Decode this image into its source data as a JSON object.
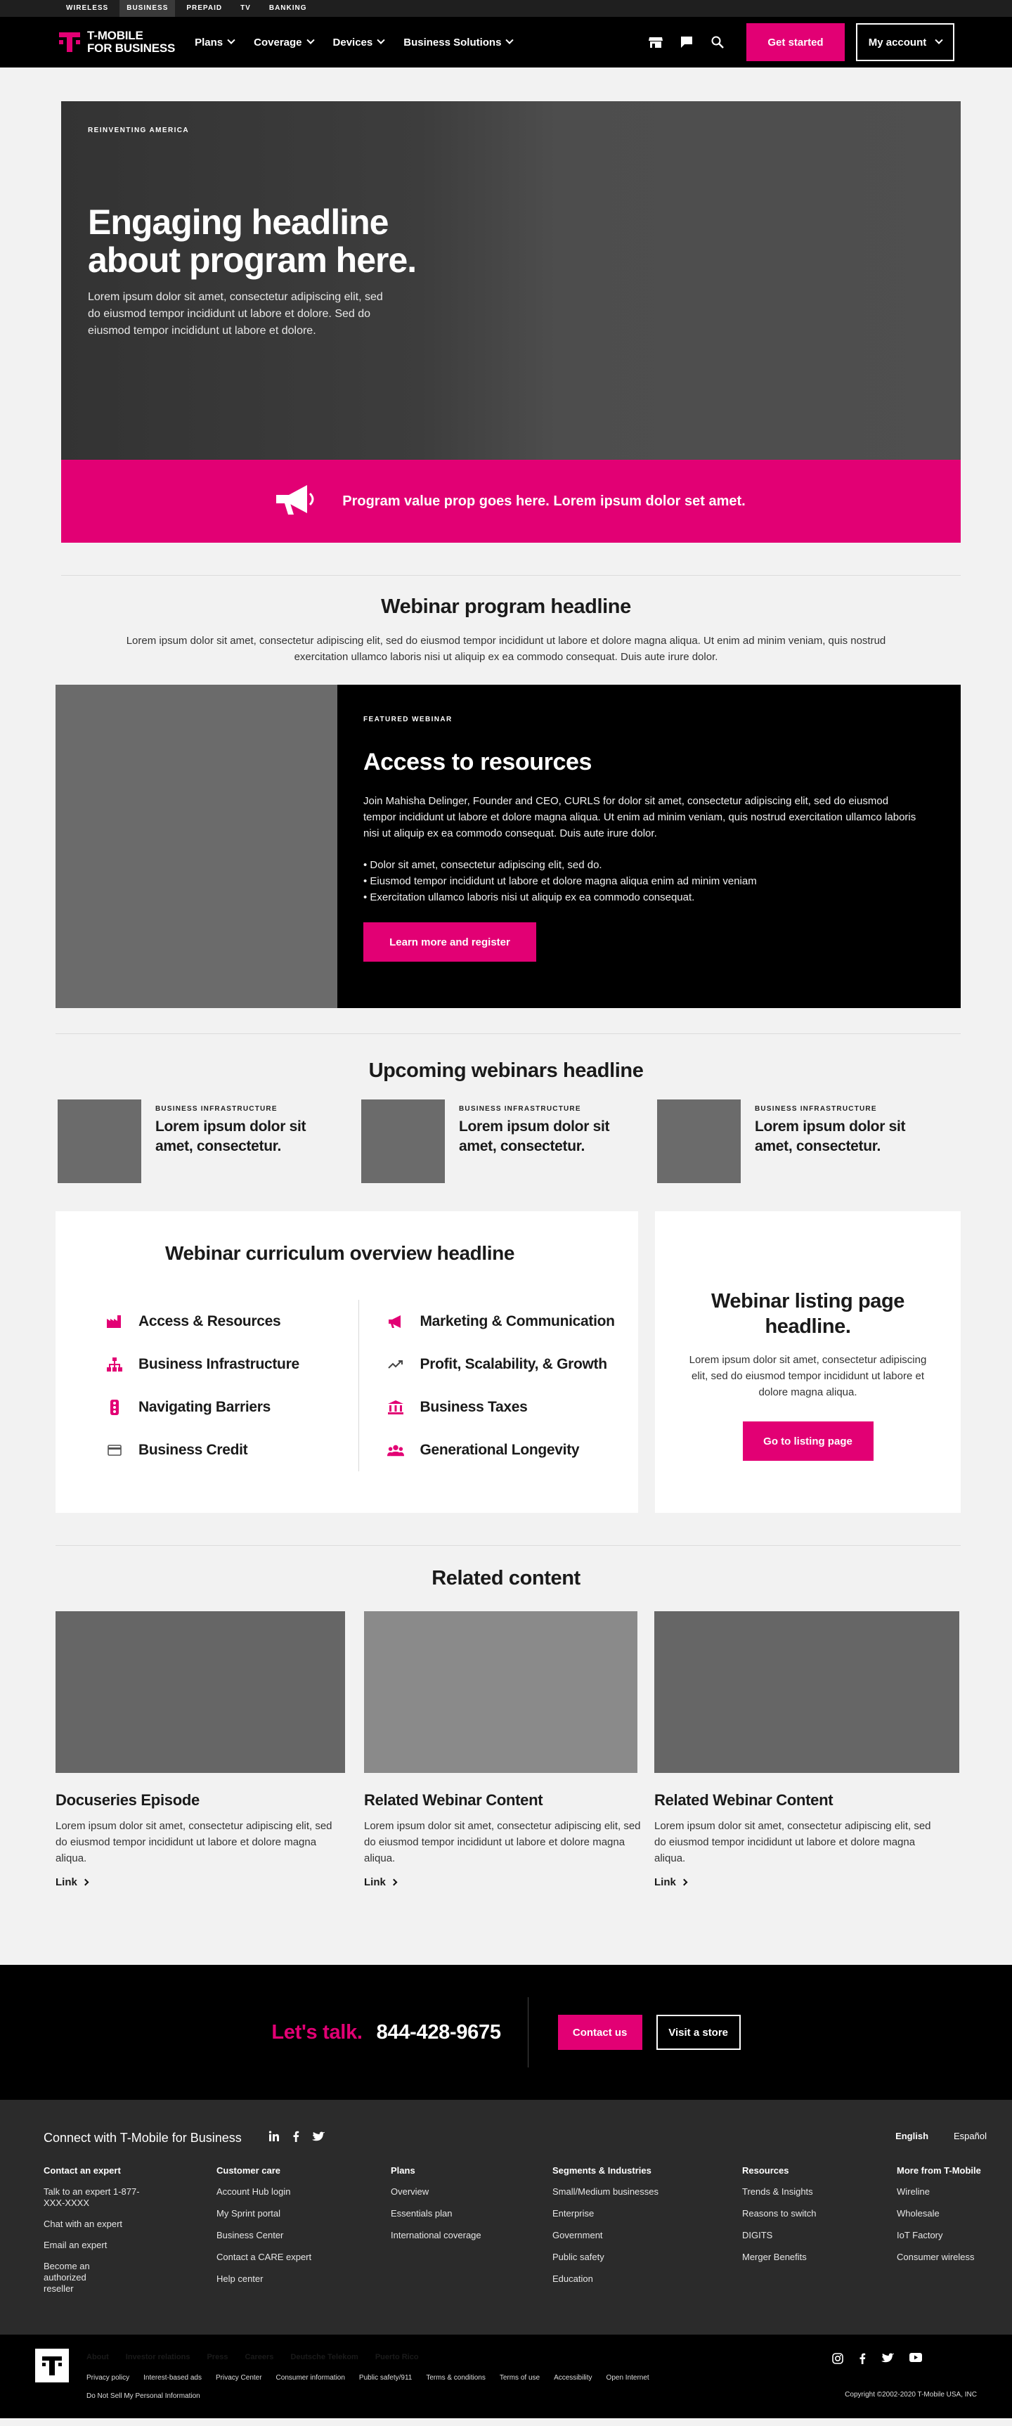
{
  "utility_bar": {
    "items": [
      "WIRELESS",
      "BUSINESS",
      "PREPAID",
      "TV",
      "BANKING"
    ],
    "active_index": 1
  },
  "nav": {
    "logo_line1": "T-MOBILE",
    "logo_line2": "FOR BUSINESS",
    "links": [
      "Plans",
      "Coverage",
      "Devices",
      "Business Solutions"
    ],
    "get_started": "Get started",
    "my_account": "My account",
    "icons": [
      "store-icon",
      "chat-icon",
      "search-icon"
    ]
  },
  "hero": {
    "eyebrow": "REINVENTING AMERICA",
    "headline": "Engaging headline about program here.",
    "body": "Lorem ipsum dolor sit amet, consectetur adipiscing elit, sed do eiusmod tempor incididunt ut labore et dolore. Sed do eiusmod tempor incididunt ut labore et dolore.",
    "value_prop": "Program value prop goes here. Lorem ipsum dolor set amet.",
    "value_icon": "megaphone-icon"
  },
  "webinar_program": {
    "headline": "Webinar program headline",
    "body": "Lorem ipsum dolor sit amet, consectetur adipiscing elit, sed do eiusmod tempor incididunt ut labore et dolore magna aliqua. Ut enim ad minim veniam, quis nostrud exercitation ullamco laboris nisi ut aliquip ex ea commodo consequat. Duis aute irure dolor."
  },
  "featured": {
    "eyebrow": "FEATURED WEBINAR",
    "title": "Access to resources",
    "description": "Join Mahisha Delinger, Founder and CEO, CURLS for dolor sit amet, consectetur adipiscing elit, sed do eiusmod tempor incididunt ut labore et dolore magna aliqua. Ut enim ad minim veniam, quis nostrud exercitation ullamco laboris nisi ut aliquip ex ea commodo consequat. Duis aute irure dolor.",
    "bullets": [
      "• Dolor sit amet, consectetur adipiscing elit, sed do.",
      "• Eiusmod tempor incididunt ut labore et dolore magna aliqua enim ad minim veniam",
      "• Exercitation ullamco laboris nisi ut aliquip ex ea commodo consequat."
    ],
    "cta": "Learn more and register"
  },
  "upcoming": {
    "headline": "Upcoming webinars headline",
    "cards": [
      {
        "eyebrow": "BUSINESS INFRASTRUCTURE",
        "title": "Lorem ipsum dolor sit amet, consectetur."
      },
      {
        "eyebrow": "BUSINESS INFRASTRUCTURE",
        "title": "Lorem ipsum dolor sit amet, consectetur."
      },
      {
        "eyebrow": "BUSINESS INFRASTRUCTURE",
        "title": "Lorem ipsum dolor sit amet, consectetur."
      }
    ]
  },
  "curriculum": {
    "headline": "Webinar curriculum overview headline",
    "left": [
      {
        "label": "Access & Resources",
        "icon": "factory-icon"
      },
      {
        "label": "Business Infrastructure",
        "icon": "org-chart-icon"
      },
      {
        "label": "Navigating Barriers",
        "icon": "traffic-light-icon"
      },
      {
        "label": "Business Credit",
        "icon": "credit-card-icon"
      }
    ],
    "right": [
      {
        "label": "Marketing & Communication",
        "icon": "megaphone-icon"
      },
      {
        "label": "Profit, Scalability, & Growth",
        "icon": "trending-up-icon"
      },
      {
        "label": "Business Taxes",
        "icon": "bank-icon"
      },
      {
        "label": "Generational Longevity",
        "icon": "people-icon"
      }
    ],
    "icon_color": "#e20074"
  },
  "listing": {
    "headline": "Webinar listing page headline.",
    "body": "Lorem ipsum dolor sit amet, consectetur adipiscing elit, sed do eiusmod tempor incididunt ut labore et dolore magna aliqua.",
    "cta": "Go to listing page"
  },
  "related": {
    "headline": "Related content",
    "cards": [
      {
        "title": "Docuseries Episode",
        "body": "Lorem ipsum dolor sit amet, consectetur adipiscing elit, sed do eiusmod tempor incididunt ut labore et dolore magna aliqua.",
        "link": "Link",
        "image_color": "#666666"
      },
      {
        "title": "Related Webinar Content",
        "body": "Lorem ipsum dolor sit amet, consectetur adipiscing elit, sed do eiusmod tempor incididunt ut labore et dolore magna aliqua.",
        "link": "Link",
        "image_color": "#8a8a8a"
      },
      {
        "title": "Related Webinar Content",
        "body": "Lorem ipsum dolor sit amet, consectetur adipiscing elit, sed do eiusmod tempor incididunt ut labore et dolore magna aliqua.",
        "link": "Link",
        "image_color": "#666666"
      }
    ]
  },
  "talk": {
    "label": "Let's talk.",
    "phone": "844-428-9675",
    "contact": "Contact us",
    "store": "Visit a store"
  },
  "footer": {
    "connect": "Connect with T-Mobile for Business",
    "socials": [
      "linkedin-icon",
      "facebook-icon",
      "twitter-icon"
    ],
    "languages": [
      "English",
      "Español"
    ],
    "columns": [
      {
        "head": "Contact an expert",
        "items": [
          "Talk to an expert 1-877-XXX-XXXX",
          "Chat with an expert",
          "Email an expert",
          "Become an authorized reseller"
        ]
      },
      {
        "head": "Customer care",
        "items": [
          "Account Hub login",
          "My Sprint portal",
          "Business Center",
          "Contact a CARE expert",
          "Help center"
        ]
      },
      {
        "head": "Plans",
        "items": [
          "Overview",
          "Essentials plan",
          "International coverage"
        ]
      },
      {
        "head": "Segments & Industries",
        "items": [
          "Small/Medium businesses",
          "Enterprise",
          "Government",
          "Public safety",
          "Education"
        ]
      },
      {
        "head": "Resources",
        "items": [
          "Trends & Insights",
          "Reasons to switch",
          "DIGITS",
          "Merger Benefits"
        ]
      },
      {
        "head": "More from T-Mobile",
        "items": [
          "Wireline",
          "Wholesale",
          "IoT Factory",
          "Consumer wireless"
        ]
      }
    ],
    "bottom_links_primary": [
      "About",
      "Investor relations",
      "Press",
      "Careers",
      "Deutsche Telekom",
      "Puerto Rico"
    ],
    "bottom_links_secondary": [
      "Privacy policy",
      "Interest-based ads",
      "Privacy Center",
      "Consumer information",
      "Public safety/911",
      "Terms & conditions",
      "Terms of use",
      "Accessibility",
      "Open Internet"
    ],
    "do_not_sell": "Do Not Sell My Personal Information",
    "bottom_socials": [
      "instagram-icon",
      "facebook-icon",
      "twitter-icon",
      "youtube-icon"
    ],
    "copyright": "Copyright ©2002-2020 T-Mobile USA, INC"
  },
  "colors": {
    "brand_magenta": "#e20074",
    "black": "#000000",
    "page_bg": "#f2f2f2",
    "footer_bg": "#2b2b2b"
  }
}
